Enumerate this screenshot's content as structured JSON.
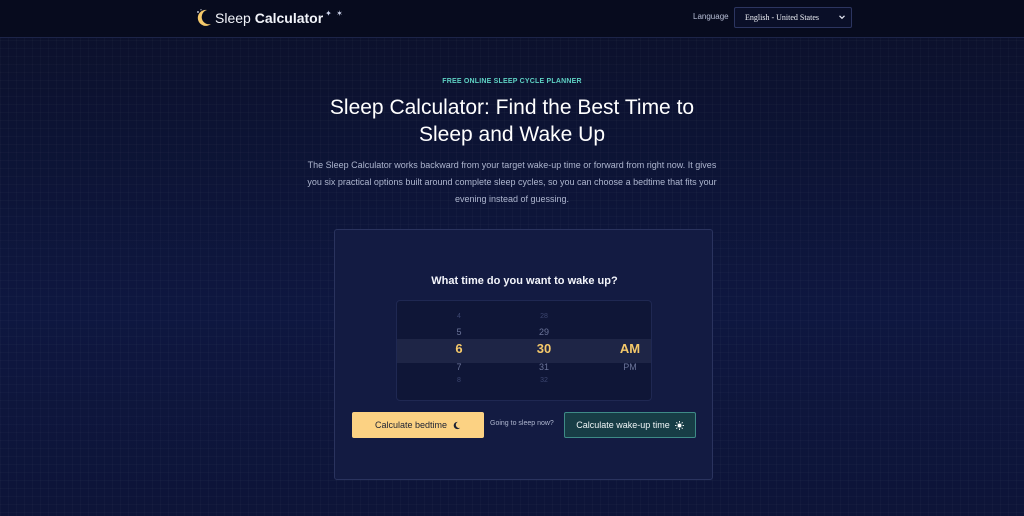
{
  "header": {
    "logo_light": "Sleep ",
    "logo_bold": "Calculator",
    "logo_icon": "crescent-moon-icon",
    "language_label": "Language",
    "language_value": "English - United States"
  },
  "hero": {
    "eyebrow": "FREE ONLINE SLEEP CYCLE PLANNER",
    "title": "Sleep Calculator: Find the Best Time to Sleep and Wake Up",
    "description": "The Sleep Calculator works backward from your target wake-up time or forward from right now. It gives you six practical options built around complete sleep cycles, so you can choose a bedtime that fits your evening instead of guessing."
  },
  "calculator": {
    "question": "What time do you want to wake up?",
    "hour": {
      "far_prev": "4",
      "prev": "5",
      "selected": "6",
      "next": "7",
      "far_next": "8"
    },
    "minute": {
      "far_prev": "28",
      "prev": "29",
      "selected": "30",
      "next": "31",
      "far_next": "32"
    },
    "period": {
      "selected": "AM",
      "next": "PM"
    },
    "bedtime_button": "Calculate bedtime",
    "now_text": "Going to sleep now?",
    "wake_button": "Calculate wake-up time",
    "accent_color": "#fcd283",
    "teal_color": "#5ed1c3"
  }
}
